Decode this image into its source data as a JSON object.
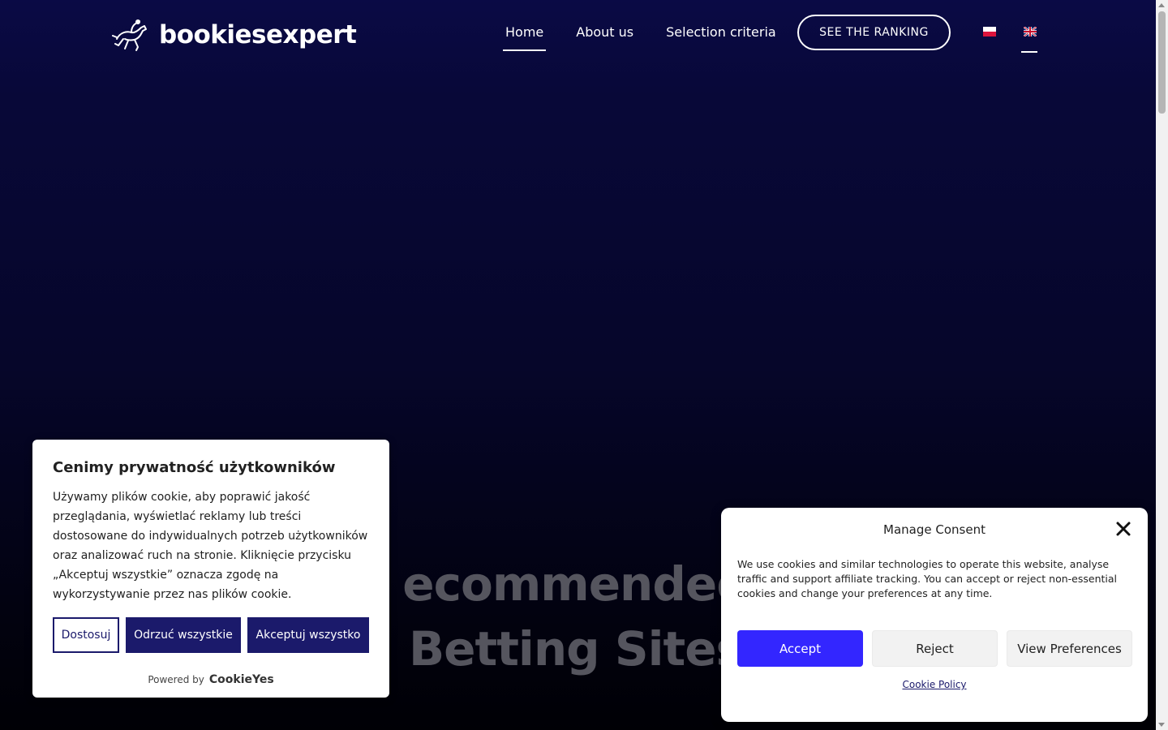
{
  "header": {
    "logo_text": "bookiesexpert",
    "nav": [
      {
        "label": "Home",
        "active": true
      },
      {
        "label": "About us",
        "active": false
      },
      {
        "label": "Selection criteria",
        "active": false
      }
    ],
    "ranking_button": "SEE THE RANKING",
    "languages": [
      {
        "code": "pl",
        "icon": "poland-flag-icon"
      },
      {
        "code": "en",
        "icon": "uk-flag-icon",
        "active": true
      }
    ]
  },
  "hero": {
    "title_line1": "ecommended",
    "title_line2": "Betting Sites"
  },
  "cookie_banner": {
    "title": "Cenimy prywatność użytkowników",
    "text": "Używamy plików cookie, aby poprawić jakość przeglądania, wyświetlać reklamy lub treści dostosowane do indywidualnych potrzeb użytkowników oraz analizować ruch na stronie. Kliknięcie przycisku „Akceptuj wszystkie” oznacza zgodę na wykorzystywanie przez nas plików cookie.",
    "customize_label": "Dostosuj",
    "reject_label": "Odrzuć wszystkie",
    "accept_label": "Akceptuj wszystko",
    "powered_by": "Powered by",
    "powered_brand": "CookieYes"
  },
  "consent_modal": {
    "title": "Manage Consent",
    "text": "We use cookies and similar technologies to operate this website, analyse traffic and support affiliate tracking. You can accept or reject non-essential cookies and change your preferences at any time.",
    "accept_label": "Accept",
    "reject_label": "Reject",
    "preferences_label": "View Preferences",
    "policy_link": "Cookie Policy"
  },
  "colors": {
    "accent": "#3326ff",
    "banner_button": "#1b1a6b",
    "background_top": "#0a0a45"
  }
}
